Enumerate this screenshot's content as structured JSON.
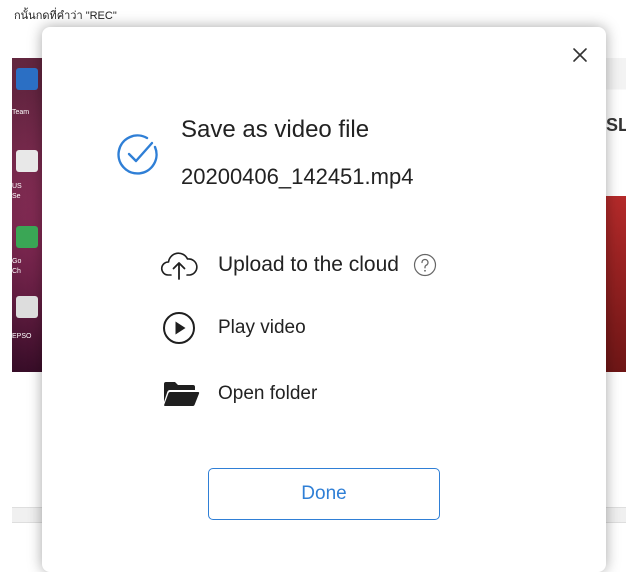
{
  "background": {
    "caption": "กนั้นกดที่คำว่า \"REC\"",
    "desktop_labels": [
      "Team",
      "US",
      "Se",
      "Go",
      "Ch",
      "EPSO"
    ],
    "right_text": "SL"
  },
  "dialog": {
    "title": "Save as video file",
    "filename": "20200406_142451.mp4",
    "actions": {
      "upload_label": "Upload to the cloud",
      "play_label": "Play video",
      "folder_label": "Open folder"
    },
    "done_label": "Done",
    "icons": {
      "close": "close-icon",
      "success": "check-circle-icon",
      "upload": "cloud-upload-icon",
      "help": "question-circle-icon",
      "play": "play-circle-icon",
      "folder": "folder-icon"
    }
  },
  "colors": {
    "accent": "#2f7fd6",
    "text": "#222222",
    "icon_dark": "#1f1f1f"
  }
}
